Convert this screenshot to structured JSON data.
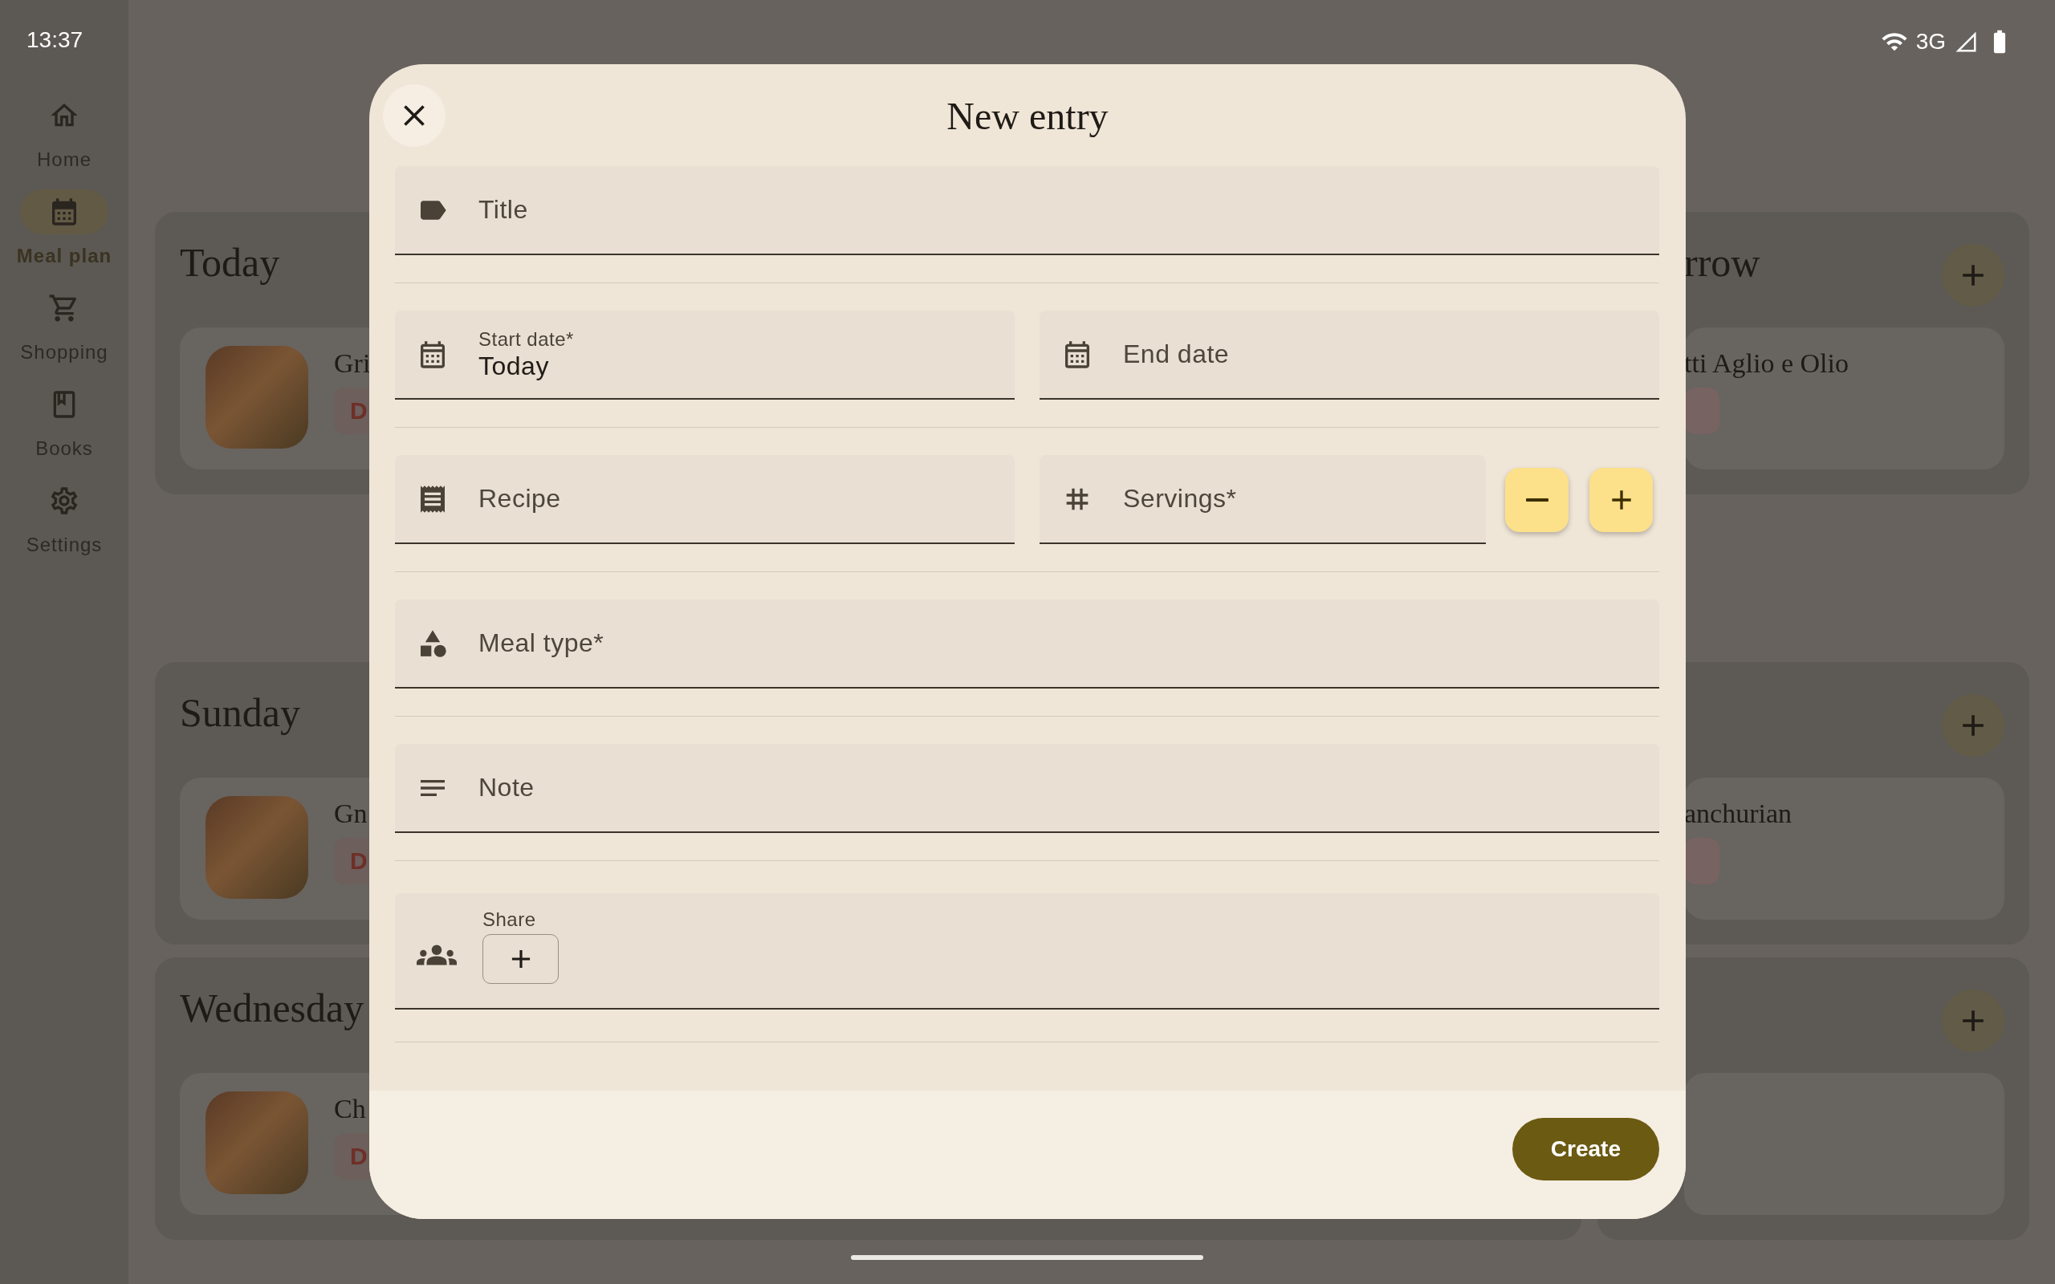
{
  "status_bar": {
    "time": "13:37",
    "network": "3G"
  },
  "nav_rail": {
    "items": [
      {
        "label": "Home",
        "selected": false
      },
      {
        "label": "Meal plan",
        "selected": true
      },
      {
        "label": "Shopping",
        "selected": false
      },
      {
        "label": "Books",
        "selected": false
      },
      {
        "label": "Settings",
        "selected": false
      }
    ]
  },
  "meal_plan": {
    "rows": [
      {
        "left": {
          "title": "Today",
          "entry": {
            "title": "Gri",
            "tag": "D"
          }
        },
        "right": {
          "title": "rrow",
          "entry": {
            "title": "tti Aglio e Olio",
            "tag_shown": true
          }
        }
      },
      {
        "left": {
          "title": "Sunday",
          "entry": {
            "title": "Gn",
            "tag": "D"
          }
        },
        "right": {
          "entry": {
            "title": "anchurian",
            "tag_shown": true
          }
        }
      },
      {
        "left": {
          "title": "Wednesday",
          "entry": {
            "title": "Ch",
            "tag": "D"
          }
        },
        "right": {
          "entry": {
            "tag_shown": false
          }
        }
      }
    ]
  },
  "dialog": {
    "title": "New entry",
    "sections": [
      [
        {
          "kind": "title",
          "placeholder": "Title"
        }
      ],
      [
        {
          "kind": "date",
          "label": "Start date*",
          "value": "Today"
        },
        {
          "kind": "date",
          "placeholder": "End date"
        }
      ],
      [
        {
          "kind": "recipe",
          "placeholder": "Recipe"
        },
        {
          "kind": "number",
          "placeholder": "Servings*"
        }
      ],
      [
        {
          "kind": "select",
          "placeholder": "Meal type*"
        }
      ],
      [
        {
          "kind": "note",
          "placeholder": "Note"
        }
      ],
      [
        {
          "kind": "share",
          "label": "Share"
        }
      ]
    ],
    "create_button": "Create"
  }
}
